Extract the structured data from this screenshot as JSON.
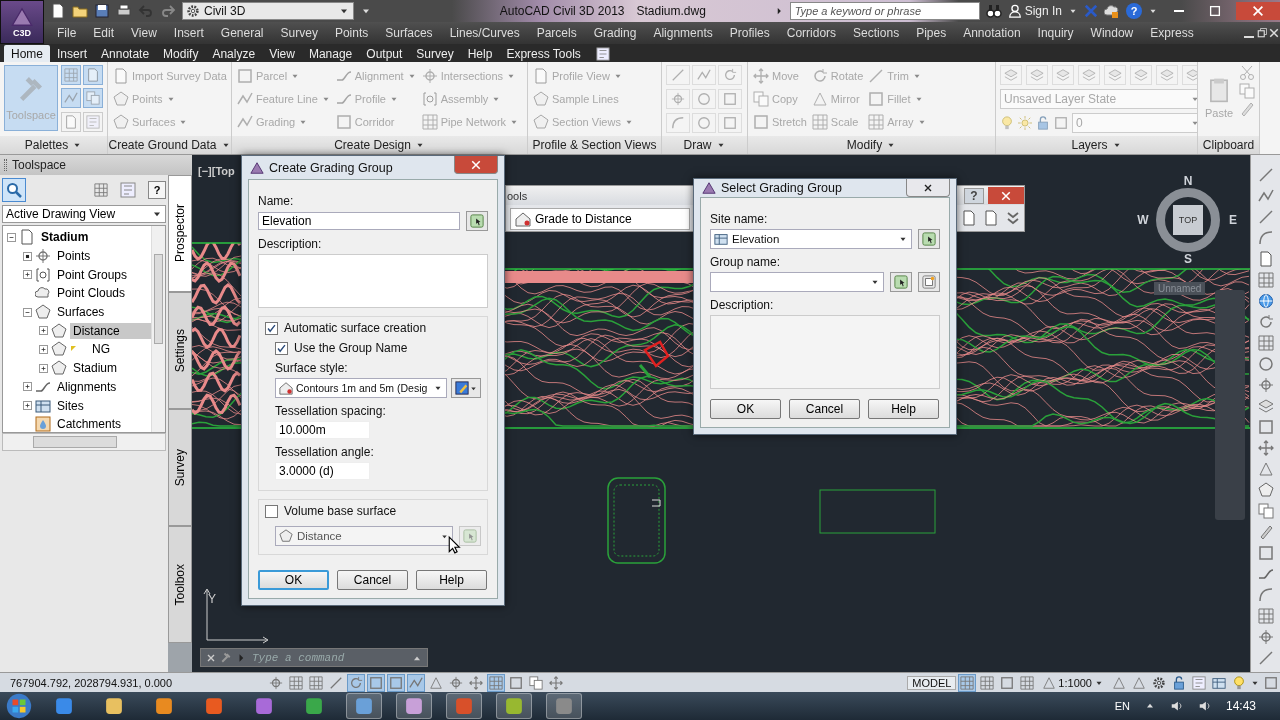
{
  "title_bar": {
    "app_badge": "C3D",
    "workspace": "Civil 3D",
    "title": "AutoCAD Civil 3D 2013",
    "file": "Stadium.dwg",
    "search": {
      "placeholder": "Type a keyword or phrase"
    },
    "sign_in": "Sign In",
    "help": "?"
  },
  "menu_bar": [
    "File",
    "Edit",
    "View",
    "Insert",
    "General",
    "Survey",
    "Points",
    "Surfaces",
    "Lines/Curves",
    "Parcels",
    "Grading",
    "Alignments",
    "Profiles",
    "Corridors",
    "Sections",
    "Pipes",
    "Annotation",
    "Inquiry",
    "Window",
    "Express"
  ],
  "ribbon_tabs": [
    {
      "label": "Home",
      "selected": true
    },
    {
      "label": "Insert",
      "selected": false
    },
    {
      "label": "Annotate",
      "selected": false
    },
    {
      "label": "Modify",
      "selected": false
    },
    {
      "label": "Analyze",
      "selected": false
    },
    {
      "label": "View",
      "selected": false
    },
    {
      "label": "Manage",
      "selected": false
    },
    {
      "label": "Output",
      "selected": false
    },
    {
      "label": "Survey",
      "selected": false
    },
    {
      "label": "Help",
      "selected": false
    },
    {
      "label": "Express Tools",
      "selected": false
    }
  ],
  "ribbon": {
    "disabled": true,
    "panels": [
      {
        "title": "Palettes",
        "menu": true,
        "kind": "palettes",
        "button": {
          "label": "Toolspace",
          "selected": true
        }
      },
      {
        "title": "Create Ground Data",
        "menu": true,
        "kind": "commands",
        "columns": [
          [
            {
              "label": "Import Survey Data",
              "dropdown": false
            },
            {
              "label": "Points",
              "dropdown": true
            },
            {
              "label": "Surfaces",
              "dropdown": true
            }
          ]
        ]
      },
      {
        "title": "Create Design",
        "menu": true,
        "kind": "commands",
        "columns": [
          [
            {
              "label": "Parcel",
              "dropdown": true
            },
            {
              "label": "Feature Line",
              "dropdown": true
            },
            {
              "label": "Grading",
              "dropdown": true
            }
          ],
          [
            {
              "label": "Alignment",
              "dropdown": true
            },
            {
              "label": "Profile",
              "dropdown": true
            },
            {
              "label": "Corridor",
              "dropdown": false
            }
          ],
          [
            {
              "label": "Intersections",
              "dropdown": true
            },
            {
              "label": "Assembly",
              "dropdown": true
            },
            {
              "label": "Pipe Network",
              "dropdown": true
            }
          ]
        ]
      },
      {
        "title": "Profile & Section Views",
        "menu": false,
        "kind": "commands",
        "columns": [
          [
            {
              "label": "Profile View",
              "dropdown": true
            },
            {
              "label": "Sample Lines",
              "dropdown": false
            },
            {
              "label": "Section Views",
              "dropdown": true
            }
          ]
        ]
      },
      {
        "title": "Draw",
        "menu": true,
        "kind": "tools"
      },
      {
        "title": "Modify",
        "menu": true,
        "kind": "commands",
        "columns": [
          [
            {
              "label": "Move",
              "dropdown": false
            },
            {
              "label": "Copy",
              "dropdown": false
            },
            {
              "label": "Stretch",
              "dropdown": false
            }
          ],
          [
            {
              "label": "Rotate",
              "dropdown": false
            },
            {
              "label": "Mirror",
              "dropdown": false
            },
            {
              "label": "Scale",
              "dropdown": false
            }
          ],
          [
            {
              "label": "Trim",
              "dropdown": true
            },
            {
              "label": "Fillet",
              "dropdown": true
            },
            {
              "label": "Array",
              "dropdown": true
            }
          ]
        ]
      },
      {
        "title": "Layers",
        "menu": true,
        "kind": "layers",
        "state": "Unsaved Layer State",
        "layer": "0"
      },
      {
        "title": "Clipboard",
        "menu": false,
        "kind": "clipboard",
        "button": "Paste"
      }
    ]
  },
  "toolspace": {
    "title": "Toolspace",
    "help": "?",
    "view": "Active Drawing View",
    "tree": [
      {
        "label": "Stadium",
        "kind": "minus",
        "selected": false,
        "children": [
          {
            "label": "Points",
            "kind": "dot",
            "selected": false
          },
          {
            "label": "Point Groups",
            "kind": "plus",
            "selected": false
          },
          {
            "label": "Point Clouds",
            "kind": "leaf",
            "selected": false
          },
          {
            "label": "Surfaces",
            "kind": "minus",
            "selected": false,
            "children": [
              {
                "label": "Distance",
                "kind": "plus",
                "selected": true,
                "out_of_date": false
              },
              {
                "label": "NG",
                "kind": "plus",
                "selected": false,
                "out_of_date": true
              },
              {
                "label": "Stadium",
                "kind": "plus",
                "selected": false,
                "out_of_date": false
              }
            ]
          },
          {
            "label": "Alignments",
            "kind": "plus",
            "selected": false
          },
          {
            "label": "Sites",
            "kind": "plus",
            "selected": false
          },
          {
            "label": "Catchments",
            "kind": "leaf",
            "selected": false
          }
        ]
      }
    ],
    "side_tabs": [
      {
        "label": "Prospector",
        "selected": true
      },
      {
        "label": "Settings",
        "selected": false
      },
      {
        "label": "Survey",
        "selected": false
      },
      {
        "label": "Toolbox",
        "selected": false
      }
    ]
  },
  "drawing": {
    "viewport_label": "[−][Top",
    "viewcube": {
      "north": "N",
      "south": "S",
      "east": "E",
      "west": "W",
      "face": "TOP"
    },
    "ucs_menu": "Unnamed",
    "ucs_axis": "Y",
    "command": {
      "placeholder": "Type a command"
    }
  },
  "tool_palette": {
    "title": "ools",
    "help": "?",
    "dropdown": "Grade to Distance"
  },
  "create_dialog": {
    "title": "Create Grading Group",
    "name_label": "Name:",
    "name": "Elevation",
    "description_label": "Description:",
    "auto_surface": {
      "label": "Automatic surface creation",
      "checked": true
    },
    "use_group_name": {
      "label": "Use the Group Name",
      "checked": true
    },
    "style_label": "Surface style:",
    "style": "Contours 1m and 5m (Desig",
    "spacing_label": "Tessellation spacing:",
    "spacing": "10.000m",
    "angle_label": "Tessellation angle:",
    "angle": "3.0000 (d)",
    "volume": {
      "label": "Volume base surface",
      "checked": false
    },
    "base_surface": {
      "value": "Distance",
      "disabled": true
    },
    "buttons": [
      {
        "label": "OK",
        "default": true
      },
      {
        "label": "Cancel",
        "default": false
      },
      {
        "label": "Help",
        "default": false
      }
    ]
  },
  "select_dialog": {
    "title": "Select Grading Group",
    "site_label": "Site name:",
    "site": "Elevation",
    "group_label": "Group name:",
    "description_label": "Description:",
    "buttons": [
      "OK",
      "Cancel",
      "Help"
    ]
  },
  "status_bar": {
    "coordinates": "767904.792, 2028794.931, 0.000",
    "space": "MODEL",
    "scale": "1:1000"
  },
  "taskbar": {
    "language": "EN",
    "time": "14:43"
  }
}
